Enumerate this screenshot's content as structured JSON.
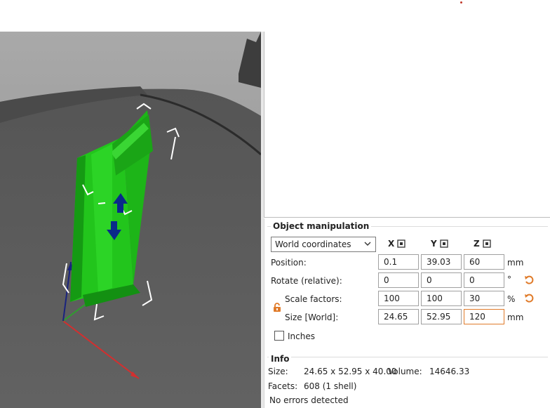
{
  "object_manipulation": {
    "title": "Object manipulation",
    "coordinate_system": "World coordinates",
    "axes": [
      "X",
      "Y",
      "Z"
    ],
    "position": {
      "label": "Position:",
      "x": "0.1",
      "y": "39.03",
      "z": "60",
      "unit": "mm"
    },
    "rotate": {
      "label": "Rotate (relative):",
      "x": "0",
      "y": "0",
      "z": "0",
      "unit": "°"
    },
    "scale": {
      "label": "Scale factors:",
      "x": "100",
      "y": "100",
      "z": "30",
      "unit": "%"
    },
    "size": {
      "label": "Size [World]:",
      "x": "24.65",
      "y": "52.95",
      "z": "120",
      "unit": "mm"
    },
    "inches_label": "Inches",
    "inches_checked": false
  },
  "info": {
    "title": "Info",
    "size_label": "Size:",
    "size_value": "24.65 x 52.95 x 40.00",
    "volume_label": "Volume:",
    "volume_value": "14646.33",
    "facets_label": "Facets:",
    "facets_value": "608 (1 shell)",
    "errors": "No errors detected"
  },
  "colors": {
    "selected_object": "#22c51c",
    "accent_orange": "#e07b2a",
    "axis_x": "#d32f2f",
    "axis_y": "#2e9e2e",
    "axis_z": "#1a237e",
    "move_arrow": "#0a2a8a"
  },
  "icons": {
    "dropdown": "chevron-down-icon",
    "axis_dir": "axis-direction-icon",
    "reset": "undo-arrow-icon",
    "lock": "unlocked-padlock-icon"
  }
}
